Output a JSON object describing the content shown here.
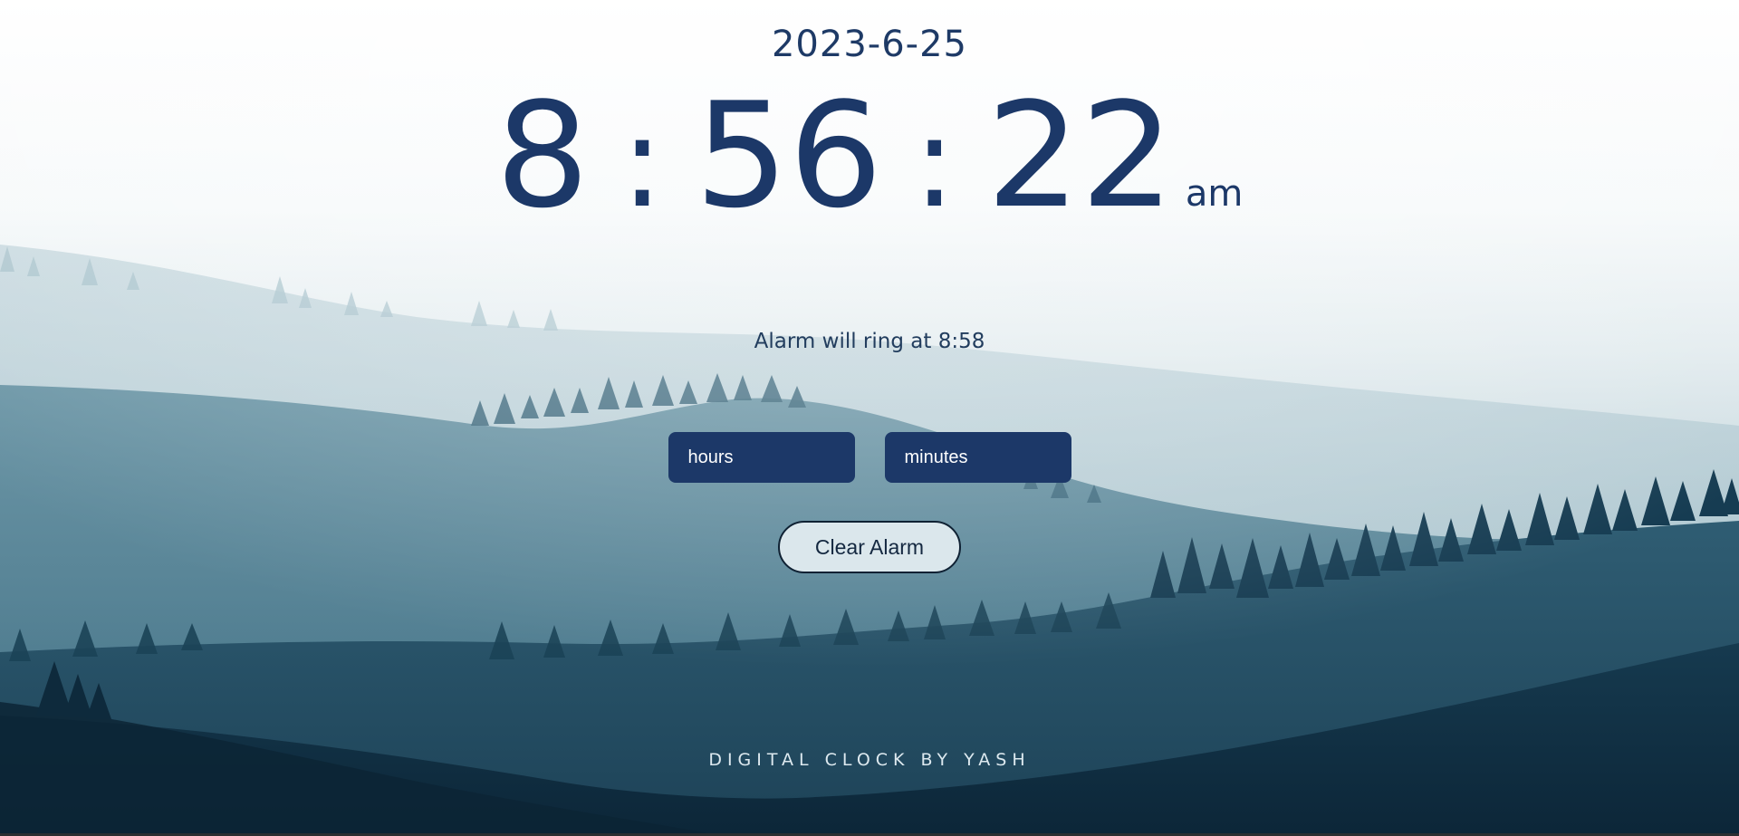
{
  "date": "2023-6-25",
  "clock": {
    "hours": "8",
    "separator": ":",
    "minutes": "56",
    "seconds": "22",
    "period": "am"
  },
  "alarm": {
    "message": "Alarm will ring at 8:58",
    "hours_placeholder": "hours",
    "minutes_placeholder": "minutes",
    "clear_label": "Clear Alarm"
  },
  "footer": {
    "credit": "DIGITAL CLOCK BY YASH"
  },
  "colors": {
    "text_primary": "#1c3868",
    "input_bg": "#1c3868",
    "button_bg": "#dbe7ec",
    "footer_text": "#dde9ef"
  }
}
